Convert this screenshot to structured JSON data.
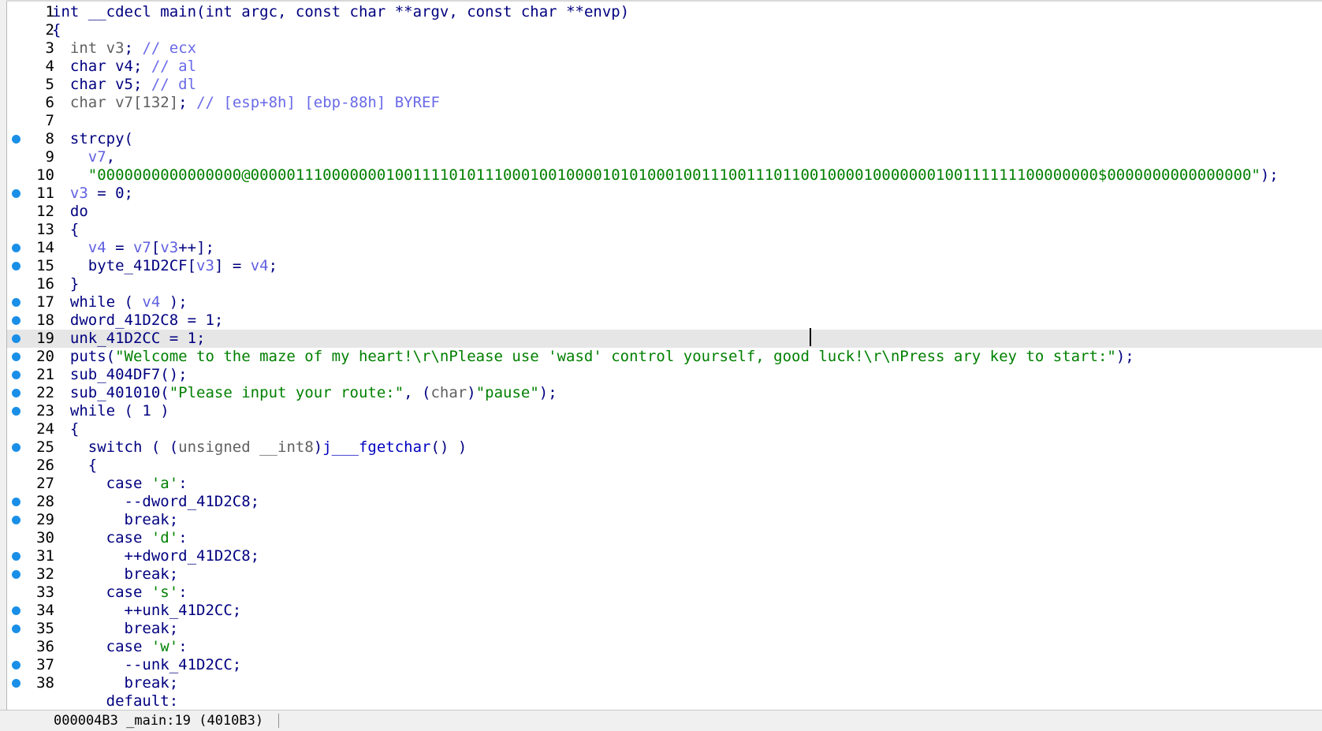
{
  "status_bar": {
    "location": "000004B3 _main:19 (4010B3)"
  },
  "caret_line": 19,
  "lines": [
    {
      "n": "1",
      "bp": false,
      "hl": false,
      "indent": "",
      "tokens": [
        [
          "kw",
          "int"
        ],
        [
          "id",
          " __cdecl main("
        ],
        [
          "kw",
          "int"
        ],
        [
          "id",
          " argc, "
        ],
        [
          "kw",
          "const char"
        ],
        [
          "id",
          " **argv, "
        ],
        [
          "kw",
          "const char"
        ],
        [
          "id",
          " **envp)"
        ]
      ]
    },
    {
      "n": "2",
      "bp": false,
      "hl": false,
      "indent": "",
      "tokens": [
        [
          "id",
          "{"
        ]
      ]
    },
    {
      "n": "3",
      "bp": false,
      "hl": false,
      "indent": "  ",
      "tokens": [
        [
          "typ",
          "int"
        ],
        [
          "id",
          " "
        ],
        [
          "typ",
          "v3"
        ],
        [
          "id",
          "; "
        ],
        [
          "cm",
          "// ecx"
        ]
      ]
    },
    {
      "n": "4",
      "bp": false,
      "hl": false,
      "indent": "  ",
      "tokens": [
        [
          "kw",
          "char"
        ],
        [
          "id",
          " v4; "
        ],
        [
          "cm",
          "// al"
        ]
      ]
    },
    {
      "n": "5",
      "bp": false,
      "hl": false,
      "indent": "  ",
      "tokens": [
        [
          "kw",
          "char"
        ],
        [
          "id",
          " v5; "
        ],
        [
          "cm",
          "// dl"
        ]
      ]
    },
    {
      "n": "6",
      "bp": false,
      "hl": false,
      "indent": "  ",
      "tokens": [
        [
          "typ",
          "char v7[132]"
        ],
        [
          "id",
          "; "
        ],
        [
          "cm",
          "// [esp+8h] [ebp-88h] BYREF"
        ]
      ]
    },
    {
      "n": "7",
      "bp": false,
      "hl": false,
      "indent": "",
      "tokens": []
    },
    {
      "n": "8",
      "bp": true,
      "hl": false,
      "indent": "  ",
      "tokens": [
        [
          "id",
          "strcpy("
        ]
      ]
    },
    {
      "n": "9",
      "bp": false,
      "hl": false,
      "indent": "    ",
      "tokens": [
        [
          "var",
          "v7"
        ],
        [
          "id",
          ","
        ]
      ]
    },
    {
      "n": "10",
      "bp": false,
      "hl": false,
      "indent": "    ",
      "tokens": [
        [
          "str",
          "\"0000000000000000@0000011100000001001111010111000100100001010100010011100111011001000010000000100111111100000000$0000000000000000\""
        ],
        [
          "id",
          ");"
        ]
      ]
    },
    {
      "n": "11",
      "bp": true,
      "hl": false,
      "indent": "  ",
      "tokens": [
        [
          "var",
          "v3"
        ],
        [
          "id",
          " = 0;"
        ]
      ]
    },
    {
      "n": "12",
      "bp": false,
      "hl": false,
      "indent": "  ",
      "tokens": [
        [
          "kw",
          "do"
        ]
      ]
    },
    {
      "n": "13",
      "bp": false,
      "hl": false,
      "indent": "  ",
      "tokens": [
        [
          "id",
          "{"
        ]
      ]
    },
    {
      "n": "14",
      "bp": true,
      "hl": false,
      "indent": "    ",
      "tokens": [
        [
          "var",
          "v4"
        ],
        [
          "id",
          " = "
        ],
        [
          "var",
          "v7"
        ],
        [
          "id",
          "["
        ],
        [
          "var",
          "v3"
        ],
        [
          "id",
          "++];"
        ]
      ]
    },
    {
      "n": "15",
      "bp": true,
      "hl": false,
      "indent": "    ",
      "tokens": [
        [
          "id",
          "byte_41D2CF["
        ],
        [
          "var",
          "v3"
        ],
        [
          "id",
          "] = "
        ],
        [
          "var",
          "v4"
        ],
        [
          "id",
          ";"
        ]
      ]
    },
    {
      "n": "16",
      "bp": false,
      "hl": false,
      "indent": "  ",
      "tokens": [
        [
          "id",
          "}"
        ]
      ]
    },
    {
      "n": "17",
      "bp": true,
      "hl": false,
      "indent": "  ",
      "tokens": [
        [
          "kw",
          "while"
        ],
        [
          "id",
          " ( "
        ],
        [
          "var",
          "v4"
        ],
        [
          "id",
          " );"
        ]
      ]
    },
    {
      "n": "18",
      "bp": true,
      "hl": false,
      "indent": "  ",
      "tokens": [
        [
          "id",
          "dword_41D2C8 = 1;"
        ]
      ]
    },
    {
      "n": "19",
      "bp": true,
      "hl": true,
      "indent": "  ",
      "tokens": [
        [
          "id",
          "unk_41D2CC = 1;"
        ]
      ]
    },
    {
      "n": "20",
      "bp": true,
      "hl": false,
      "indent": "  ",
      "tokens": [
        [
          "id",
          "puts("
        ],
        [
          "str",
          "\"Welcome to the maze of my heart!\\r\\nPlease use 'wasd' control yourself, good luck!\\r\\nPress ary key to start:\""
        ],
        [
          "id",
          ");"
        ]
      ]
    },
    {
      "n": "21",
      "bp": true,
      "hl": false,
      "indent": "  ",
      "tokens": [
        [
          "id",
          "sub_404DF7();"
        ]
      ]
    },
    {
      "n": "22",
      "bp": true,
      "hl": false,
      "indent": "  ",
      "tokens": [
        [
          "id",
          "sub_401010("
        ],
        [
          "str",
          "\"Please input your route:\""
        ],
        [
          "id",
          ", ("
        ],
        [
          "typ",
          "char"
        ],
        [
          "id",
          ")"
        ],
        [
          "str",
          "\"pause\""
        ],
        [
          "id",
          ");"
        ]
      ]
    },
    {
      "n": "23",
      "bp": true,
      "hl": false,
      "indent": "  ",
      "tokens": [
        [
          "kw",
          "while"
        ],
        [
          "id",
          " ( 1 )"
        ]
      ]
    },
    {
      "n": "24",
      "bp": false,
      "hl": false,
      "indent": "  ",
      "tokens": [
        [
          "id",
          "{"
        ]
      ]
    },
    {
      "n": "25",
      "bp": true,
      "hl": false,
      "indent": "    ",
      "tokens": [
        [
          "kw",
          "switch"
        ],
        [
          "id",
          " ( ("
        ],
        [
          "typ",
          "unsigned __int8"
        ],
        [
          "id",
          ")"
        ],
        [
          "fn",
          "j___fgetchar"
        ],
        [
          "id",
          "() )"
        ]
      ]
    },
    {
      "n": "26",
      "bp": false,
      "hl": false,
      "indent": "    ",
      "tokens": [
        [
          "id",
          "{"
        ]
      ]
    },
    {
      "n": "27",
      "bp": false,
      "hl": false,
      "indent": "      ",
      "tokens": [
        [
          "kw",
          "case"
        ],
        [
          "id",
          " "
        ],
        [
          "str",
          "'a'"
        ],
        [
          "id",
          ":"
        ]
      ]
    },
    {
      "n": "28",
      "bp": true,
      "hl": false,
      "indent": "        ",
      "tokens": [
        [
          "id",
          "--dword_41D2C8;"
        ]
      ]
    },
    {
      "n": "29",
      "bp": true,
      "hl": false,
      "indent": "        ",
      "tokens": [
        [
          "kw",
          "break"
        ],
        [
          "id",
          ";"
        ]
      ]
    },
    {
      "n": "30",
      "bp": false,
      "hl": false,
      "indent": "      ",
      "tokens": [
        [
          "kw",
          "case"
        ],
        [
          "id",
          " "
        ],
        [
          "str",
          "'d'"
        ],
        [
          "id",
          ":"
        ]
      ]
    },
    {
      "n": "31",
      "bp": true,
      "hl": false,
      "indent": "        ",
      "tokens": [
        [
          "id",
          "++dword_41D2C8;"
        ]
      ]
    },
    {
      "n": "32",
      "bp": true,
      "hl": false,
      "indent": "        ",
      "tokens": [
        [
          "kw",
          "break"
        ],
        [
          "id",
          ";"
        ]
      ]
    },
    {
      "n": "33",
      "bp": false,
      "hl": false,
      "indent": "      ",
      "tokens": [
        [
          "kw",
          "case"
        ],
        [
          "id",
          " "
        ],
        [
          "str",
          "'s'"
        ],
        [
          "id",
          ":"
        ]
      ]
    },
    {
      "n": "34",
      "bp": true,
      "hl": false,
      "indent": "        ",
      "tokens": [
        [
          "id",
          "++unk_41D2CC;"
        ]
      ]
    },
    {
      "n": "35",
      "bp": true,
      "hl": false,
      "indent": "        ",
      "tokens": [
        [
          "kw",
          "break"
        ],
        [
          "id",
          ";"
        ]
      ]
    },
    {
      "n": "36",
      "bp": false,
      "hl": false,
      "indent": "      ",
      "tokens": [
        [
          "kw",
          "case"
        ],
        [
          "id",
          " "
        ],
        [
          "str",
          "'w'"
        ],
        [
          "id",
          ":"
        ]
      ]
    },
    {
      "n": "37",
      "bp": true,
      "hl": false,
      "indent": "        ",
      "tokens": [
        [
          "id",
          "--unk_41D2CC;"
        ]
      ]
    },
    {
      "n": "38",
      "bp": true,
      "hl": false,
      "indent": "        ",
      "tokens": [
        [
          "kw",
          "break"
        ],
        [
          "id",
          ";"
        ]
      ]
    },
    {
      "n": "",
      "bp": false,
      "hl": false,
      "indent": "      ",
      "tokens": [
        [
          "kw",
          "default"
        ],
        [
          "id",
          ":"
        ]
      ]
    }
  ]
}
